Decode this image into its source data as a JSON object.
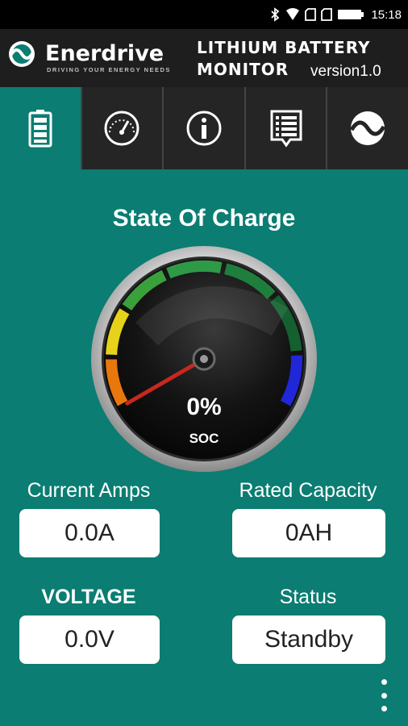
{
  "status_bar": {
    "time": "15:18"
  },
  "header": {
    "brand": "Enerdrive",
    "tagline": "DRIVING YOUR ENERGY NEEDS",
    "title_line1": "LITHIUM BATTERY",
    "title_line2": "MONITOR",
    "version": "version1.0"
  },
  "tabs": [
    {
      "icon": "battery-icon",
      "active": true
    },
    {
      "icon": "speedometer-icon",
      "active": false
    },
    {
      "icon": "info-icon",
      "active": false
    },
    {
      "icon": "list-icon",
      "active": false
    },
    {
      "icon": "enerdrive-logo-icon",
      "active": false
    }
  ],
  "gauge": {
    "title": "State Of Charge",
    "value": "0%",
    "label": "SOC",
    "soc_percent": 0
  },
  "fields": {
    "current_amps_label": "Current Amps",
    "current_amps_value": "0.0A",
    "rated_capacity_label": "Rated Capacity",
    "rated_capacity_value": "0AH",
    "voltage_label": "VOLTAGE",
    "voltage_value": "0.0V",
    "status_label": "Status",
    "status_value": "Standby"
  },
  "colors": {
    "background": "#0b7d72",
    "header": "#1e1e1e",
    "needle": "#c8281e"
  }
}
